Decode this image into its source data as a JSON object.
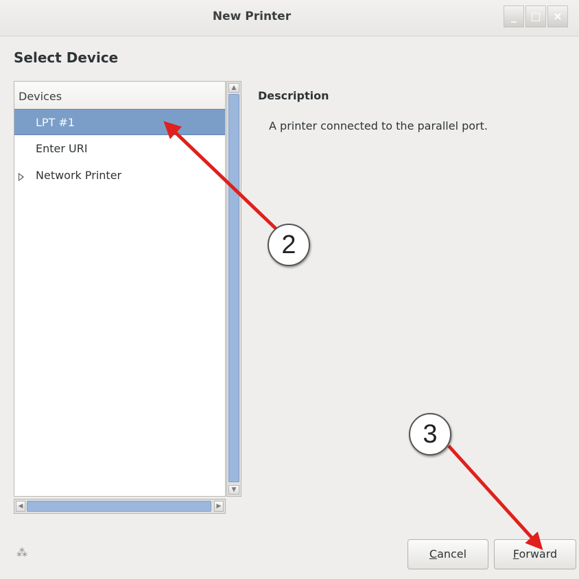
{
  "window": {
    "title": "New Printer",
    "controls": [
      "minimize-icon",
      "maximize-icon",
      "close-icon"
    ]
  },
  "page": {
    "heading": "Select Device"
  },
  "device_list": {
    "header": "Devices",
    "items": [
      {
        "label": "LPT #1",
        "selected": true
      },
      {
        "label": "Enter URI",
        "selected": false
      },
      {
        "label": "Network Printer",
        "selected": false,
        "expandable": true
      }
    ]
  },
  "description": {
    "label": "Description",
    "text": "A printer connected to the parallel port."
  },
  "buttons": {
    "cancel": {
      "mnemonic": "C",
      "rest": "ancel"
    },
    "forward": {
      "mnemonic": "F",
      "rest": "orward"
    }
  },
  "annotations": {
    "callout_2": "2",
    "callout_3": "3",
    "arrow_color": "#e0201c"
  },
  "colors": {
    "selection": "#7b9ec9",
    "scroll_thumb": "#9cb7dc",
    "window_bg": "#efeeec"
  }
}
